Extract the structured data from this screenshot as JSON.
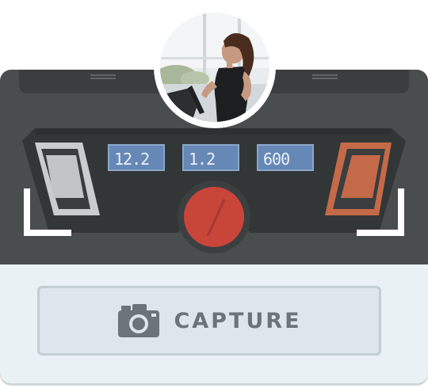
{
  "treadmill": {
    "displays": [
      "12.2",
      "1.2",
      "600"
    ]
  },
  "avatar": {
    "icon": "runner-photo"
  },
  "capture": {
    "label": "CAPTURE",
    "icon": "camera-icon"
  },
  "colors": {
    "console": "#4a4d4e",
    "display": "#6688b6",
    "stop_button": "#c8453a",
    "right_pad": "#c46a48",
    "left_pad": "#cfd3d3",
    "card_bg": "#e9f1f5"
  }
}
